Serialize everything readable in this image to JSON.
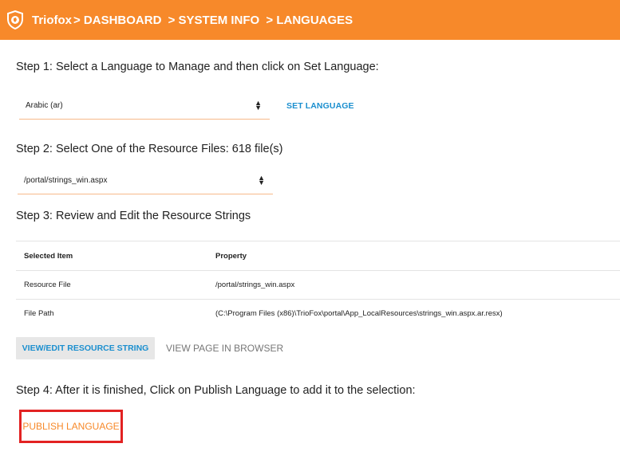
{
  "header": {
    "brand": "Triofox",
    "breadcrumb": [
      "> DASHBOARD",
      "> SYSTEM INFO",
      "> LANGUAGES"
    ]
  },
  "step1": {
    "text": "Step 1: Select a Language to Manage and then click on Set Language:",
    "selected_language": "Arabic (ar)",
    "set_language_label": "SET LANGUAGE"
  },
  "step2": {
    "text": "Step 2: Select One of the Resource Files: 618 file(s)",
    "selected_file": "/portal/strings_win.aspx"
  },
  "step3": {
    "text": "Step 3: Review and Edit the Resource Strings",
    "table": {
      "headers": [
        "Selected Item",
        "Property"
      ],
      "rows": [
        [
          "Resource File",
          "/portal/strings_win.aspx"
        ],
        [
          "File Path",
          "(C:\\Program Files (x86)\\TrioFox\\portal\\App_LocalResources\\strings_win.aspx.ar.resx)"
        ]
      ]
    },
    "view_edit_label": "VIEW/EDIT RESOURCE STRING",
    "view_browser_label": "VIEW PAGE IN BROWSER"
  },
  "step4": {
    "text": "Step 4: After it is finished, Click on Publish Language to add it to the selection:",
    "publish_label": "PUBLISH LANGUAGE"
  },
  "colors": {
    "accent": "#f7892a",
    "link": "#1b8fcf",
    "highlight_border": "#e22222"
  }
}
